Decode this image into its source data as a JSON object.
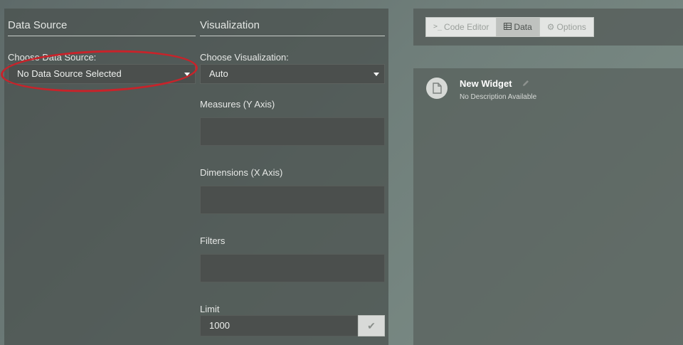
{
  "data_source": {
    "section_title": "Data Source",
    "choose_label": "Choose Data Source:",
    "selected": "No Data Source Selected"
  },
  "visualization": {
    "section_title": "Visualization",
    "choose_label": "Choose Visualization:",
    "selected": "Auto",
    "measures_label": "Measures (Y Axis)",
    "dimensions_label": "Dimensions (X Axis)",
    "filters_label": "Filters",
    "limit_label": "Limit",
    "limit_value": "1000"
  },
  "toolbar": {
    "tabs": [
      {
        "label": "Code Editor",
        "icon": "terminal-icon",
        "active": false
      },
      {
        "label": "Data",
        "icon": "table-icon",
        "active": true
      },
      {
        "label": "Options",
        "icon": "gear-icon",
        "active": false
      }
    ]
  },
  "widget": {
    "title": "New Widget",
    "description": "No Description Available",
    "icon": "file-icon"
  },
  "annotation": {
    "highlight_color": "#c8232a"
  }
}
